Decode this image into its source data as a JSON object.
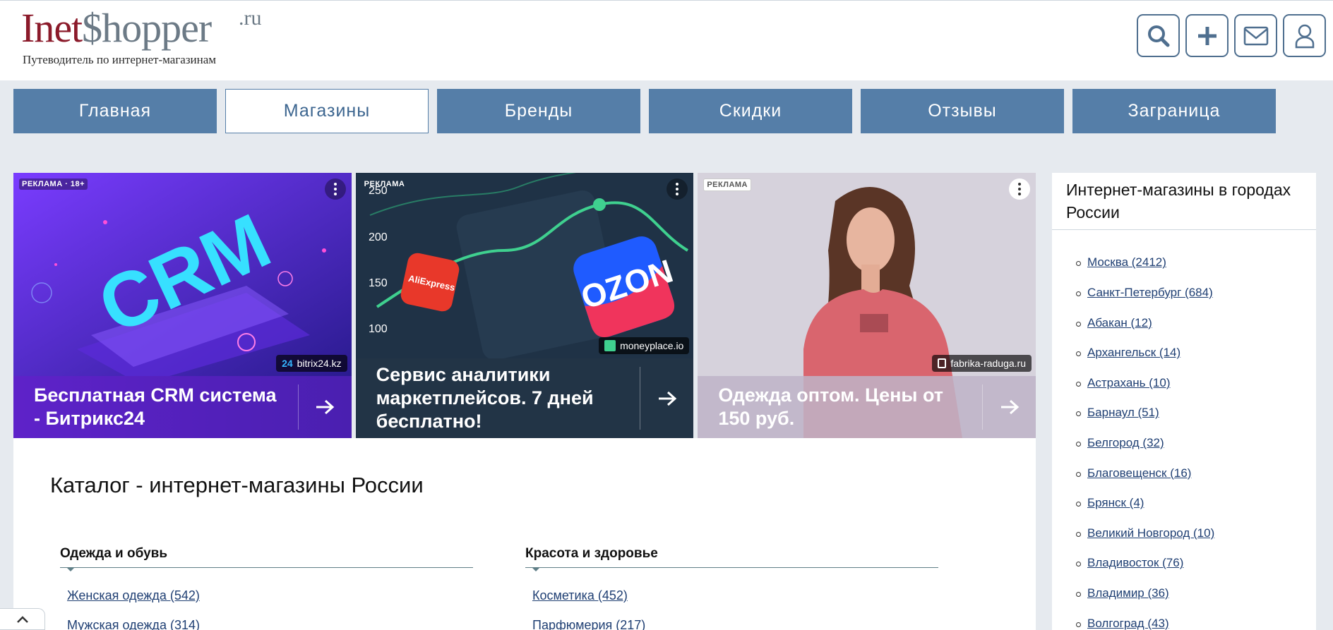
{
  "logo": {
    "part1": "Inet",
    "part2": "$hopper",
    "suffix": ".ru",
    "tagline": "Путеводитель по интернет-магазинам"
  },
  "header_buttons": [
    {
      "icon": "search-icon"
    },
    {
      "icon": "plus-icon"
    },
    {
      "icon": "mail-icon"
    },
    {
      "icon": "user-icon"
    }
  ],
  "nav": {
    "items": [
      "Главная",
      "Магазины",
      "Бренды",
      "Скидки",
      "Отзывы",
      "Заграница"
    ],
    "active": "Магазины"
  },
  "ads": [
    {
      "label": "РЕКЛАМА · 18+",
      "title": "Бесплатная CRM система - Битрикс24",
      "domain": "bitrix24.kz",
      "art_text": "CRM"
    },
    {
      "label": "РЕКЛАМА",
      "title": "Сервис аналитики маркетплейсов. 7 дней бесплатно!",
      "domain": "moneyplace.io",
      "art_ticks": [
        "250",
        "200",
        "150",
        "100"
      ],
      "art_badges": [
        "AliExpress",
        "OZON"
      ]
    },
    {
      "label": "РЕКЛАМА",
      "title": "Одежда оптом. Цены от 150 руб.",
      "domain": "fabrika-raduga.ru"
    }
  ],
  "main": {
    "title": "Каталог - интернет-магазины России",
    "categories": [
      {
        "name": "Одежда и обувь",
        "items": [
          "Женская одежда (542)",
          "Мужская одежда (314)"
        ]
      },
      {
        "name": "Красота и здоровье",
        "items": [
          "Косметика (452)",
          "Парфюмерия (217)"
        ]
      }
    ]
  },
  "sidebar": {
    "title": "Интернет-магазины в городах России",
    "cities": [
      "Москва (2412)",
      "Санкт-Петербург (684)",
      "Абакан (12)",
      "Архангельск (14)",
      "Астрахань (10)",
      "Барнаул (51)",
      "Белгород (32)",
      "Благовещенск (16)",
      "Брянск (4)",
      "Великий Новгород (10)",
      "Владивосток (76)",
      "Владимир (36)",
      "Волгоград (43)"
    ]
  },
  "colors": {
    "nav_bg": "#557ea8",
    "logo_red": "#8b1a2a",
    "link": "#1f3f73",
    "page_bg": "#e6eaef"
  }
}
